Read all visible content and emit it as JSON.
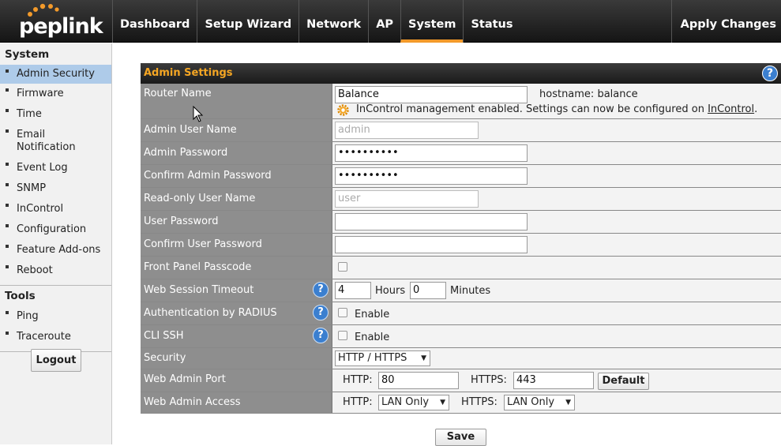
{
  "brand": {
    "logo_text": "peplink"
  },
  "nav": {
    "items": [
      {
        "label": "Dashboard",
        "active": false
      },
      {
        "label": "Setup Wizard",
        "active": false
      },
      {
        "label": "Network",
        "active": false
      },
      {
        "label": "AP",
        "active": false
      },
      {
        "label": "System",
        "active": true
      },
      {
        "label": "Status",
        "active": false
      }
    ],
    "apply_label": "Apply Changes"
  },
  "sidebar": {
    "system_heading": "System",
    "items": [
      {
        "label": "Admin Security",
        "active": true
      },
      {
        "label": "Firmware"
      },
      {
        "label": "Time"
      },
      {
        "label": "Email Notification"
      },
      {
        "label": "Event Log"
      },
      {
        "label": "SNMP"
      },
      {
        "label": "InControl"
      },
      {
        "label": "Configuration"
      },
      {
        "label": "Feature Add-ons"
      },
      {
        "label": "Reboot"
      }
    ],
    "tools_heading": "Tools",
    "tools": [
      {
        "label": "Ping"
      },
      {
        "label": "Traceroute"
      }
    ],
    "logout_label": "Logout"
  },
  "panel": {
    "title": "Admin Settings",
    "help": "?",
    "router_name": {
      "label": "Router Name",
      "value": "Balance",
      "hostname": "hostname: balance",
      "notice": "InControl management enabled. Settings can now be configured on ",
      "notice_link": "InControl",
      "notice_end": "."
    },
    "admin_user": {
      "label": "Admin User Name",
      "placeholder": "admin"
    },
    "admin_password": {
      "label": "Admin Password",
      "value": "••••••••••"
    },
    "confirm_admin_password": {
      "label": "Confirm Admin Password",
      "value": "••••••••••"
    },
    "readonly_user": {
      "label": "Read-only User Name",
      "placeholder": "user"
    },
    "user_password": {
      "label": "User Password",
      "value": ""
    },
    "confirm_user_password": {
      "label": "Confirm User Password",
      "value": ""
    },
    "front_panel": {
      "label": "Front Panel Passcode",
      "checked": false
    },
    "session_timeout": {
      "label": "Web Session Timeout",
      "hours": "4",
      "hours_label": "Hours",
      "minutes": "0",
      "minutes_label": "Minutes"
    },
    "radius": {
      "label": "Authentication by RADIUS",
      "enable_label": "Enable",
      "checked": false
    },
    "cli_ssh": {
      "label": "CLI SSH",
      "enable_label": "Enable",
      "checked": false
    },
    "security": {
      "label": "Security",
      "selected": "HTTP / HTTPS"
    },
    "admin_port": {
      "label": "Web Admin Port",
      "http_label": "HTTP:",
      "http": "80",
      "https_label": "HTTPS:",
      "https": "443",
      "default_label": "Default"
    },
    "admin_access": {
      "label": "Web Admin Access",
      "http_label": "HTTP:",
      "http": "LAN Only",
      "https_label": "HTTPS:",
      "https": "LAN Only"
    },
    "save_label": "Save"
  },
  "colors": {
    "accent": "#f39a2a",
    "header_text": "#f5a623",
    "label_bg": "#8e8e8e",
    "active_side": "#aecbe9",
    "help_blue": "#3b7fcf"
  }
}
